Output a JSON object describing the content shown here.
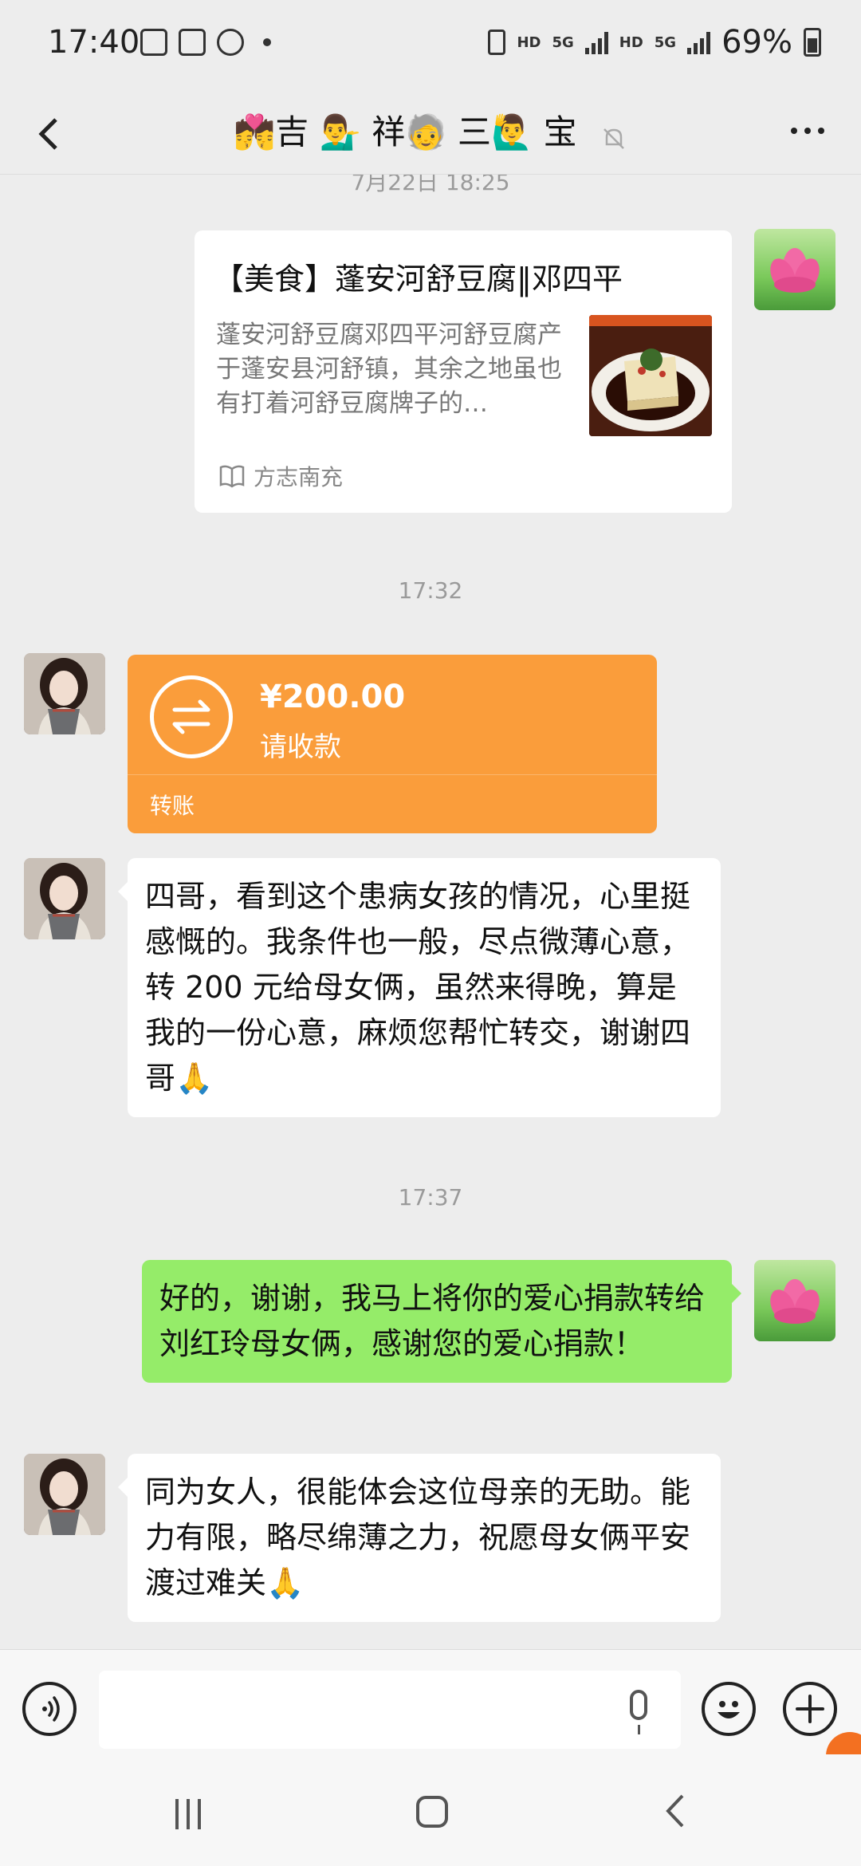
{
  "status_bar": {
    "time": "17:40",
    "hd1": "HD",
    "net1": "5G",
    "hd2": "HD",
    "net2": "5G",
    "battery": "69%"
  },
  "header": {
    "title": "💏吉 💁‍♂️ 祥🧓 三🙋‍♂️ 宝",
    "back_icon": "chevron-left-icon",
    "mute_icon": "bell-muted-icon",
    "more_icon": "more-dots-icon"
  },
  "messages": {
    "partial_timestamp": "7月22日 18:25",
    "card": {
      "title": "【美食】蓬安河舒豆腐‖邓四平",
      "description": "蓬安河舒豆腐邓四平河舒豆腐产于蓬安县河舒镇，其余之地虽也有打着河舒豆腐牌子的…",
      "source": "方志南充"
    },
    "time1": "17:32",
    "transfer": {
      "amount": "¥200.00",
      "status": "请收款",
      "label": "转账"
    },
    "text1": "四哥，看到这个患病女孩的情况，心里挺感慨的。我条件也一般，尽点微薄心意，转 200 元给母女俩，虽然来得晚，算是我的一份心意，麻烦您帮忙转交，谢谢四哥🙏",
    "time2": "17:37",
    "text2": "好的，谢谢，我马上将你的爱心捐款转给刘红玲母女俩，感谢您的爱心捐款！",
    "text3": "同为女人，很能体会这位母亲的无助。能力有限，略尽绵薄之力，祝愿母女俩平安渡过难关🙏"
  },
  "input_bar": {
    "value": "",
    "voice_icon": "voice-mode-icon",
    "mic_icon": "mic-icon",
    "emoji_icon": "emoji-icon",
    "plus_icon": "plus-icon"
  },
  "colors": {
    "chat_bg": "#ededed",
    "green_bubble": "#95ec69",
    "transfer_orange": "#fa9d3b"
  }
}
